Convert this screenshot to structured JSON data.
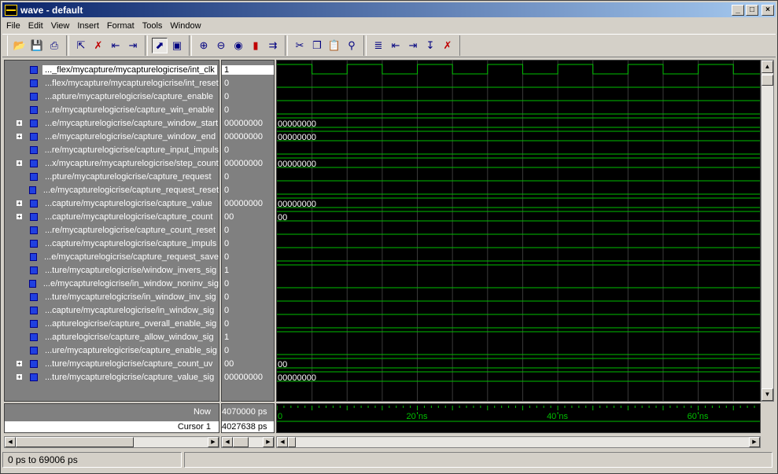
{
  "window": {
    "title": "wave - default",
    "minimize": "_",
    "maximize": "□",
    "close": "×"
  },
  "menu": [
    "File",
    "Edit",
    "View",
    "Insert",
    "Format",
    "Tools",
    "Window"
  ],
  "toolbar": {
    "groups": [
      [
        "folder-open-icon",
        "save-icon",
        "print-icon"
      ],
      [
        "add-wave-icon",
        "delete-wave-icon",
        "expand-wave-icon",
        "collapse-wave-icon"
      ],
      [
        "select-pointer-icon",
        "zoom-box-icon"
      ],
      [
        "zoom-in-icon",
        "zoom-out-icon",
        "zoom-full-icon",
        "traffic-light-icon",
        "step-icon"
      ],
      [
        "cut-icon",
        "copy-icon",
        "paste-icon",
        "find-icon"
      ],
      [
        "insert-cursor-icon",
        "cursor-left-icon",
        "cursor-right-icon",
        "cursor-down-icon",
        "delete-cursor-icon"
      ]
    ]
  },
  "signals": [
    {
      "name": "..._flex/mycapture/mycapturelogicrise/int_clk",
      "value": "1",
      "bus": false,
      "selected": true
    },
    {
      "name": "...flex/mycapture/mycapturelogicrise/int_reset",
      "value": "0",
      "bus": false
    },
    {
      "name": "...apture/mycapturelogicrise/capture_enable",
      "value": "0",
      "bus": false
    },
    {
      "name": "...re/mycapturelogicrise/capture_win_enable",
      "value": "0",
      "bus": false
    },
    {
      "name": "...e/mycapturelogicrise/capture_window_start",
      "value": "00000000",
      "bus": true
    },
    {
      "name": "...e/mycapturelogicrise/capture_window_end",
      "value": "00000000",
      "bus": true
    },
    {
      "name": "...re/mycapturelogicrise/capture_input_impuls",
      "value": "0",
      "bus": false
    },
    {
      "name": "...x/mycapture/mycapturelogicrise/step_count",
      "value": "00000000",
      "bus": true
    },
    {
      "name": "...pture/mycapturelogicrise/capture_request",
      "value": "0",
      "bus": false
    },
    {
      "name": "...e/mycapturelogicrise/capture_request_reset",
      "value": "0",
      "bus": false
    },
    {
      "name": "...capture/mycapturelogicrise/capture_value",
      "value": "00000000",
      "bus": true
    },
    {
      "name": "...capture/mycapturelogicrise/capture_count",
      "value": "00",
      "bus": true
    },
    {
      "name": "...re/mycapturelogicrise/capture_count_reset",
      "value": "0",
      "bus": false
    },
    {
      "name": "...capture/mycapturelogicrise/capture_impuls",
      "value": "0",
      "bus": false
    },
    {
      "name": "...e/mycapturelogicrise/capture_request_save",
      "value": "0",
      "bus": false
    },
    {
      "name": "...ture/mycapturelogicrise/window_invers_sig",
      "value": "1",
      "bus": false
    },
    {
      "name": "...e/mycapturelogicrise/in_window_noninv_sig",
      "value": "0",
      "bus": false
    },
    {
      "name": "...ture/mycapturelogicrise/in_window_inv_sig",
      "value": "0",
      "bus": false
    },
    {
      "name": "...capture/mycapturelogicrise/in_window_sig",
      "value": "0",
      "bus": false
    },
    {
      "name": "...apturelogicrise/capture_overall_enable_sig",
      "value": "0",
      "bus": false
    },
    {
      "name": "...apturelogicrise/capture_allow_window_sig",
      "value": "1",
      "bus": false
    },
    {
      "name": "...ure/mycapturelogicrise/capture_enable_sig",
      "value": "0",
      "bus": false
    },
    {
      "name": "...ture/mycapturelogicrise/capture_count_uv",
      "value": "00",
      "bus": true
    },
    {
      "name": "...ture/mycapturelogicrise/capture_value_sig",
      "value": "00000000",
      "bus": true
    }
  ],
  "now": {
    "label": "Now",
    "value": "4070000 ps"
  },
  "cursor": {
    "label": "Cursor 1",
    "value": "4027638 ps"
  },
  "ruler": {
    "start_label": "0",
    "ticks": [
      "20 ns",
      "40 ns",
      "60 ns"
    ],
    "range_ns": [
      0,
      69.006
    ]
  },
  "status": {
    "range": "0 ps to 69006 ps"
  },
  "colors": {
    "wave": "#00c000",
    "background": "#000000",
    "cursor": "#c8c800",
    "signal_icon": "#2040e0"
  }
}
